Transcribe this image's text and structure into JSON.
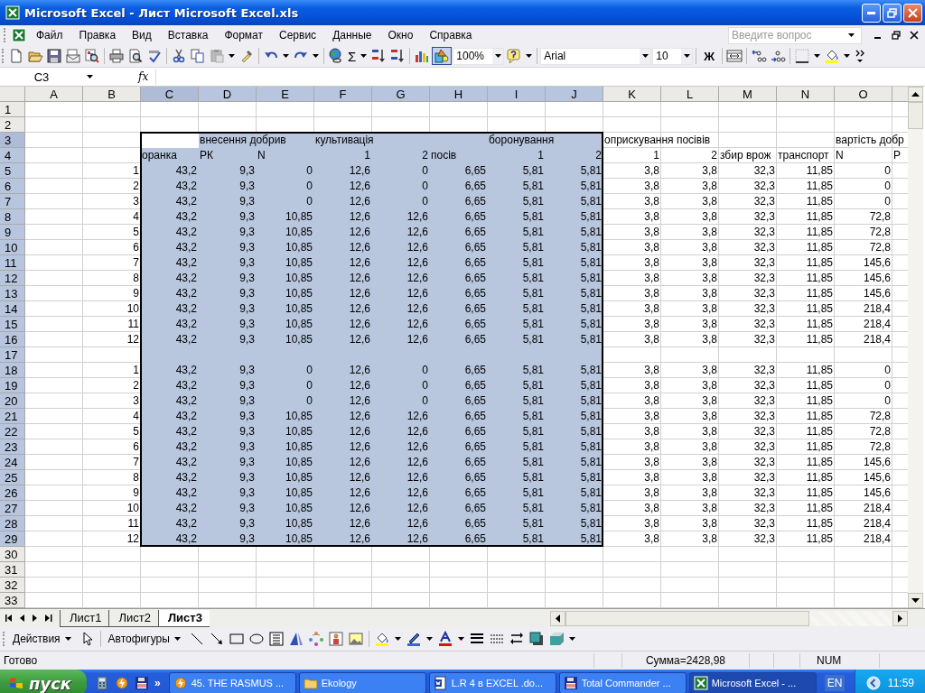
{
  "window": {
    "title": "Microsoft Excel - Лист Microsoft Excel.xls"
  },
  "menu": [
    {
      "label": "Файл"
    },
    {
      "label": "Правка"
    },
    {
      "label": "Вид"
    },
    {
      "label": "Вставка"
    },
    {
      "label": "Формат"
    },
    {
      "label": "Сервис"
    },
    {
      "label": "Данные"
    },
    {
      "label": "Окно"
    },
    {
      "label": "Справка"
    }
  ],
  "help_search": {
    "placeholder": "Введите вопрос"
  },
  "toolbar": {
    "sum_symbol": "Σ",
    "zoom": "100%",
    "font": "Arial",
    "font_size": "10",
    "bold": "Ж"
  },
  "formula_bar": {
    "name_box": "C3",
    "fx": "fx"
  },
  "columns": [
    {
      "label": "A",
      "selected": false,
      "active": false
    },
    {
      "label": "B",
      "selected": false,
      "active": false
    },
    {
      "label": "C",
      "selected": true,
      "active": true
    },
    {
      "label": "D",
      "selected": true,
      "active": false
    },
    {
      "label": "E",
      "selected": true,
      "active": false
    },
    {
      "label": "F",
      "selected": true,
      "active": false
    },
    {
      "label": "G",
      "selected": true,
      "active": false
    },
    {
      "label": "H",
      "selected": true,
      "active": false
    },
    {
      "label": "I",
      "selected": true,
      "active": false
    },
    {
      "label": "J",
      "selected": true,
      "active": false
    },
    {
      "label": "K",
      "selected": false,
      "active": false
    },
    {
      "label": "L",
      "selected": false,
      "active": false
    },
    {
      "label": "M",
      "selected": false,
      "active": false
    },
    {
      "label": "N",
      "selected": false,
      "active": false
    },
    {
      "label": "O",
      "selected": false,
      "active": false
    },
    {
      "selected": false,
      "active": false
    }
  ],
  "rows": [
    {
      "label": "1",
      "selected": false,
      "active": false
    },
    {
      "label": "2",
      "selected": false,
      "active": false
    },
    {
      "label": "3",
      "selected": true,
      "active": true,
      "cells": [
        null,
        null,
        null,
        {
          "text": "внесення добрив",
          "kind": "text"
        },
        null,
        {
          "text": "культивація",
          "kind": "text"
        },
        null,
        null,
        {
          "text": "боронування",
          "kind": "text"
        },
        null,
        {
          "text": "оприскування посівів",
          "kind": "text"
        },
        null,
        null,
        null,
        {
          "text": "вартість добр",
          "kind": "text"
        }
      ]
    },
    {
      "label": "4",
      "selected": true,
      "active": false,
      "cells": [
        null,
        null,
        {
          "text": "оранка",
          "kind": "text"
        },
        {
          "text": "РК",
          "kind": "text"
        },
        {
          "text": "N",
          "kind": "text"
        },
        "1",
        "2",
        {
          "text": "посів",
          "kind": "text"
        },
        "1",
        "2",
        "1",
        "2",
        {
          "text": "збир врож",
          "kind": "text"
        },
        {
          "text": "транспорт",
          "kind": "text"
        },
        {
          "text": "N",
          "kind": "text"
        },
        {
          "text": "P",
          "kind": "text"
        }
      ]
    },
    {
      "label": "5",
      "selected": true,
      "active": false,
      "cells": [
        null,
        "1",
        "43,2",
        "9,3",
        "0",
        "12,6",
        "0",
        "6,65",
        "5,81",
        "5,81",
        "3,8",
        "3,8",
        "32,3",
        "11,85",
        "0"
      ]
    },
    {
      "label": "6",
      "selected": true,
      "active": false,
      "cells": [
        null,
        "2",
        "43,2",
        "9,3",
        "0",
        "12,6",
        "0",
        "6,65",
        "5,81",
        "5,81",
        "3,8",
        "3,8",
        "32,3",
        "11,85",
        "0"
      ]
    },
    {
      "label": "7",
      "selected": true,
      "active": false,
      "cells": [
        null,
        "3",
        "43,2",
        "9,3",
        "0",
        "12,6",
        "0",
        "6,65",
        "5,81",
        "5,81",
        "3,8",
        "3,8",
        "32,3",
        "11,85",
        "0"
      ]
    },
    {
      "label": "8",
      "selected": true,
      "active": false,
      "cells": [
        null,
        "4",
        "43,2",
        "9,3",
        "10,85",
        "12,6",
        "12,6",
        "6,65",
        "5,81",
        "5,81",
        "3,8",
        "3,8",
        "32,3",
        "11,85",
        "72,8"
      ]
    },
    {
      "label": "9",
      "selected": true,
      "active": false,
      "cells": [
        null,
        "5",
        "43,2",
        "9,3",
        "10,85",
        "12,6",
        "12,6",
        "6,65",
        "5,81",
        "5,81",
        "3,8",
        "3,8",
        "32,3",
        "11,85",
        "72,8"
      ]
    },
    {
      "label": "10",
      "selected": true,
      "active": false,
      "cells": [
        null,
        "6",
        "43,2",
        "9,3",
        "10,85",
        "12,6",
        "12,6",
        "6,65",
        "5,81",
        "5,81",
        "3,8",
        "3,8",
        "32,3",
        "11,85",
        "72,8"
      ]
    },
    {
      "label": "11",
      "selected": true,
      "active": false,
      "cells": [
        null,
        "7",
        "43,2",
        "9,3",
        "10,85",
        "12,6",
        "12,6",
        "6,65",
        "5,81",
        "5,81",
        "3,8",
        "3,8",
        "32,3",
        "11,85",
        "145,6"
      ]
    },
    {
      "label": "12",
      "selected": true,
      "active": false,
      "cells": [
        null,
        "8",
        "43,2",
        "9,3",
        "10,85",
        "12,6",
        "12,6",
        "6,65",
        "5,81",
        "5,81",
        "3,8",
        "3,8",
        "32,3",
        "11,85",
        "145,6"
      ]
    },
    {
      "label": "13",
      "selected": true,
      "active": false,
      "cells": [
        null,
        "9",
        "43,2",
        "9,3",
        "10,85",
        "12,6",
        "12,6",
        "6,65",
        "5,81",
        "5,81",
        "3,8",
        "3,8",
        "32,3",
        "11,85",
        "145,6"
      ]
    },
    {
      "label": "14",
      "selected": true,
      "active": false,
      "cells": [
        null,
        "10",
        "43,2",
        "9,3",
        "10,85",
        "12,6",
        "12,6",
        "6,65",
        "5,81",
        "5,81",
        "3,8",
        "3,8",
        "32,3",
        "11,85",
        "218,4"
      ]
    },
    {
      "label": "15",
      "selected": true,
      "active": false,
      "cells": [
        null,
        "11",
        "43,2",
        "9,3",
        "10,85",
        "12,6",
        "12,6",
        "6,65",
        "5,81",
        "5,81",
        "3,8",
        "3,8",
        "32,3",
        "11,85",
        "218,4"
      ]
    },
    {
      "label": "16",
      "selected": true,
      "active": false,
      "cells": [
        null,
        "12",
        "43,2",
        "9,3",
        "10,85",
        "12,6",
        "12,6",
        "6,65",
        "5,81",
        "5,81",
        "3,8",
        "3,8",
        "32,3",
        "11,85",
        "218,4"
      ]
    },
    {
      "label": "17",
      "selected": true,
      "active": false
    },
    {
      "label": "18",
      "selected": true,
      "active": false,
      "cells": [
        null,
        "1",
        "43,2",
        "9,3",
        "0",
        "12,6",
        "0",
        "6,65",
        "5,81",
        "5,81",
        "3,8",
        "3,8",
        "32,3",
        "11,85",
        "0"
      ]
    },
    {
      "label": "19",
      "selected": true,
      "active": false,
      "cells": [
        null,
        "2",
        "43,2",
        "9,3",
        "0",
        "12,6",
        "0",
        "6,65",
        "5,81",
        "5,81",
        "3,8",
        "3,8",
        "32,3",
        "11,85",
        "0"
      ]
    },
    {
      "label": "20",
      "selected": true,
      "active": false,
      "cells": [
        null,
        "3",
        "43,2",
        "9,3",
        "0",
        "12,6",
        "0",
        "6,65",
        "5,81",
        "5,81",
        "3,8",
        "3,8",
        "32,3",
        "11,85",
        "0"
      ]
    },
    {
      "label": "21",
      "selected": true,
      "active": false,
      "cells": [
        null,
        "4",
        "43,2",
        "9,3",
        "10,85",
        "12,6",
        "12,6",
        "6,65",
        "5,81",
        "5,81",
        "3,8",
        "3,8",
        "32,3",
        "11,85",
        "72,8"
      ]
    },
    {
      "label": "22",
      "selected": true,
      "active": false,
      "cells": [
        null,
        "5",
        "43,2",
        "9,3",
        "10,85",
        "12,6",
        "12,6",
        "6,65",
        "5,81",
        "5,81",
        "3,8",
        "3,8",
        "32,3",
        "11,85",
        "72,8"
      ]
    },
    {
      "label": "23",
      "selected": true,
      "active": false,
      "cells": [
        null,
        "6",
        "43,2",
        "9,3",
        "10,85",
        "12,6",
        "12,6",
        "6,65",
        "5,81",
        "5,81",
        "3,8",
        "3,8",
        "32,3",
        "11,85",
        "72,8"
      ]
    },
    {
      "label": "24",
      "selected": true,
      "active": false,
      "cells": [
        null,
        "7",
        "43,2",
        "9,3",
        "10,85",
        "12,6",
        "12,6",
        "6,65",
        "5,81",
        "5,81",
        "3,8",
        "3,8",
        "32,3",
        "11,85",
        "145,6"
      ]
    },
    {
      "label": "25",
      "selected": true,
      "active": false,
      "cells": [
        null,
        "8",
        "43,2",
        "9,3",
        "10,85",
        "12,6",
        "12,6",
        "6,65",
        "5,81",
        "5,81",
        "3,8",
        "3,8",
        "32,3",
        "11,85",
        "145,6"
      ]
    },
    {
      "label": "26",
      "selected": true,
      "active": false,
      "cells": [
        null,
        "9",
        "43,2",
        "9,3",
        "10,85",
        "12,6",
        "12,6",
        "6,65",
        "5,81",
        "5,81",
        "3,8",
        "3,8",
        "32,3",
        "11,85",
        "145,6"
      ]
    },
    {
      "label": "27",
      "selected": true,
      "active": false,
      "cells": [
        null,
        "10",
        "43,2",
        "9,3",
        "10,85",
        "12,6",
        "12,6",
        "6,65",
        "5,81",
        "5,81",
        "3,8",
        "3,8",
        "32,3",
        "11,85",
        "218,4"
      ]
    },
    {
      "label": "28",
      "selected": true,
      "active": false,
      "cells": [
        null,
        "11",
        "43,2",
        "9,3",
        "10,85",
        "12,6",
        "12,6",
        "6,65",
        "5,81",
        "5,81",
        "3,8",
        "3,8",
        "32,3",
        "11,85",
        "218,4"
      ]
    },
    {
      "label": "29",
      "selected": true,
      "active": false,
      "cells": [
        null,
        "12",
        "43,2",
        "9,3",
        "10,85",
        "12,6",
        "12,6",
        "6,65",
        "5,81",
        "5,81",
        "3,8",
        "3,8",
        "32,3",
        "11,85",
        "218,4"
      ]
    },
    {
      "label": "30",
      "selected": false,
      "active": false
    },
    {
      "label": "31",
      "selected": false,
      "active": false
    },
    {
      "label": "32",
      "selected": false,
      "active": false
    },
    {
      "label": "33",
      "selected": false,
      "active": false
    }
  ],
  "sheet_tabs": [
    {
      "label": "Лист1",
      "selected": false
    },
    {
      "label": "Лист2",
      "selected": false
    },
    {
      "label": "Лист3",
      "selected": true
    }
  ],
  "drawing_toolbar": {
    "actions": "Действия",
    "autoshapes": "Автофигуры"
  },
  "status_bar": {
    "status": "Готово",
    "sum": "Сумма=2428,98",
    "num": "NUM"
  },
  "taskbar": {
    "start": "пуск",
    "more": "»",
    "tasks": [
      {
        "label": "45. THE RASMUS ...",
        "kind": "player",
        "selected": false
      },
      {
        "label": "Ekology",
        "kind": "folder",
        "selected": false
      },
      {
        "label": "L.R 4 в EXCEL .do...",
        "kind": "document",
        "selected": false
      },
      {
        "label": "Total Commander ...",
        "kind": "disk",
        "selected": false
      },
      {
        "label": "Microsoft Excel - ...",
        "kind": "spreadsheet",
        "selected": true
      }
    ],
    "language": "EN",
    "clock": "11:59"
  }
}
